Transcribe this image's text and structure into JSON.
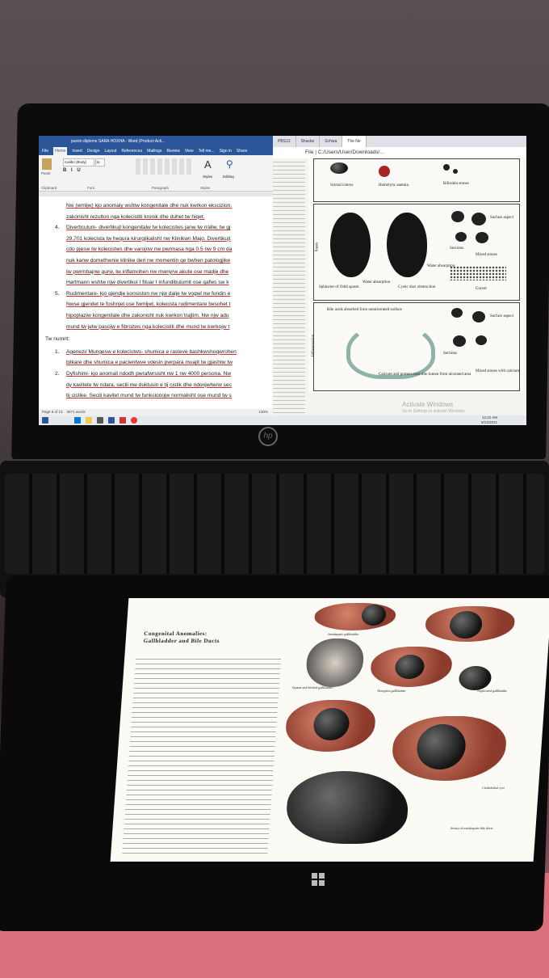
{
  "word": {
    "title": "punim diplome SARA HOXHA - Word (Product Acti...",
    "tabs": [
      "File",
      "Home",
      "Insert",
      "Design",
      "Layout",
      "References",
      "Mailings",
      "Review",
      "View",
      "Tell me...",
      "Sign in",
      "Share"
    ],
    "font_name": "Calibri (Body)",
    "font_size": "11",
    "groups": [
      "Clipboard",
      "Font",
      "Paragraph",
      "Styles",
      "Editing"
    ],
    "paste_label": "Paste",
    "styles_label": "Styles",
    "editing_label": "Editing",
    "lines": [
      {
        "num": "",
        "text": "Nw (wmijw) kjo anomaly wshtw kongenitale dhe nuk kwrkon ekscizion."
      },
      {
        "num": "",
        "text": "zakonisht rezulton nga kolecistiti kronik dhe duhet tw hiqet."
      },
      {
        "num": "4.",
        "text": "Diverticulum- divertikujt kongenitalw tw kolecistws janw tw rrallw, tw gj"
      },
      {
        "num": "",
        "text": "29,701 kolecista tw hequra kirurgjikalisht nw Klinikwn Majo. Divertikujt"
      },
      {
        "num": "",
        "text": "cdo pjesw tw kolecistws dhe varojnw nw pwrmasa nga 0.5 nw 9 cm da"
      },
      {
        "num": "",
        "text": "nuk kanw domethwnie klinike deri nw momentin qe bwhen patologjike"
      },
      {
        "num": "",
        "text": "tw pwrmbajnw gurw, tw inflamohen nw mwnyrw akute ose madje dhe"
      },
      {
        "num": "",
        "text": "Hartmann wshtw njw divertikul I fituar I infundibulumit ose qafws sw k"
      },
      {
        "num": "5.",
        "text": "Rudimentare- kjo gjendje konsiston nw njw dalje tw vogwl nw fundin e"
      },
      {
        "num": "",
        "text": "Nwse gjendet te foshnjet ose fwmijwt, kolecista rudimentare besohet t"
      },
      {
        "num": "",
        "text": "hipoplaziw kongenitale dhe zakonisht nuk kwrkon trajtim. Nw njw adu"
      },
      {
        "num": "",
        "text": "mund tw jetw pasojw e fibrozws nga kolecistiti dhe mund tw kwrkojw t"
      }
    ],
    "heading": "Tw numrit:",
    "lines2": [
      {
        "num": "1.",
        "text": "Agenezi/ Mungesw e kolecistws- shumica e rasteve bashkwshoqwrohen"
      },
      {
        "num": "",
        "text": "bilkare dhe shumica e pacientwve vdesin pwrpara muajit tw gjashtw tw"
      },
      {
        "num": "2.",
        "text": "Dyfishimi- kjo anomali ndodh pwrafwrsisht nw 1 nw 4000 persona. Nw"
      },
      {
        "num": "",
        "text": "dy kavitete tw ndara, secili me duktusin e tij cistik dhe ndonjwherw sec"
      },
      {
        "num": "",
        "text": "tij cistike. Secili kavitet mund tw funksionojw normalisht ose mund tw s"
      }
    ],
    "status_page": "Page 8 of 13",
    "status_words": "3871 words",
    "zoom": "130%"
  },
  "browser": {
    "tabs": [
      "PBS13",
      "Shacke",
      "Schwa",
      "The Ne"
    ],
    "address": "File | C:/Users/User/Downloads/...",
    "figure_labels": {
      "scleral": "Scleral icterus",
      "hemolytic": "Hemolytic anemia",
      "bilirubin": "Bilirubin stones",
      "stasis": "Stasis",
      "surface": "Surface aspect",
      "sections": "Sections",
      "mixed": "Mixed stones",
      "water1": "Water absorption",
      "water2": "Water absorption",
      "sphincter": "Sphincter of Oddi spasm",
      "cystic": "Cystic duct obstruction",
      "gravel": "Gravel",
      "bileacids": "Bile acids absorbed from nonulcerated surface",
      "inflammation": "Inflammation",
      "calcium": "Calcium and protein ooze into lumen from ulcerated area",
      "surface2": "Surface aspect",
      "sections2": "Sections",
      "mixedcalcium": "Mixed stones with calcium"
    },
    "activate_title": "Activate Windows",
    "activate_sub": "Go to Settings to activate Windows."
  },
  "taskbar": {
    "time": "12:22 AM",
    "date": "5/14/2021"
  },
  "tablet": {
    "heading_line1": "Congenital Anomalies:",
    "heading_line2": "Gallbladder and Bile Ducts",
    "captions": [
      "Intrahepatic gallbladder",
      "Septate and bilobed gallbladder",
      "Hourglass gallbladder",
      "Duplicated gallbladder",
      "Choledochal cyst",
      "Atresia of extrahepatic bile ducts"
    ]
  },
  "brand": {
    "hp": "hp"
  }
}
